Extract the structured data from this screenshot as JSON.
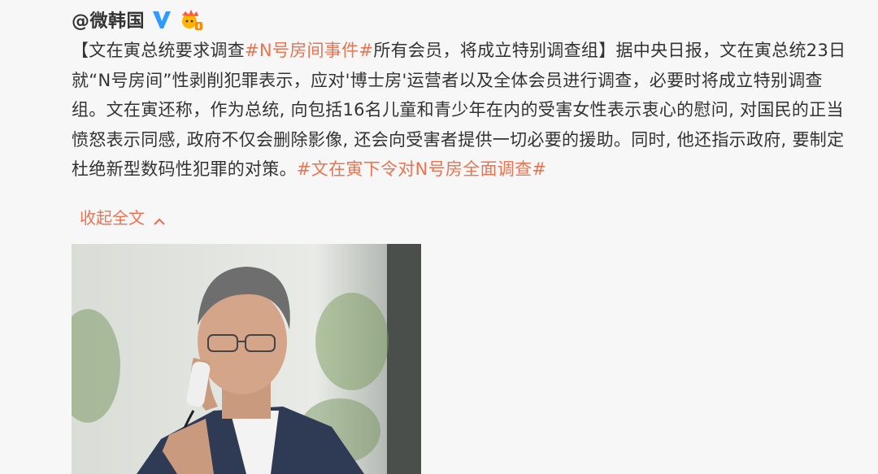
{
  "post": {
    "author": "@微韩国",
    "verified_icon": "verified-v-icon",
    "member_icon": "crown-member-icon",
    "text": {
      "lead": "【文在寅总统要求调查",
      "tag1": "#N号房间事件#",
      "body": "所有会员，将成立特别调查组】据中央日报，文在寅总统23日就“N号房间”性剥削犯罪表示，应对'博士房'运营者以及全体会员进行调查，必要时将成立特别调查组。文在寅还称，作为总统, 向包括16名儿童和青少年在内的受害女性表示衷心的慰问, 对国民的正当愤怒表示同感, 政府不仅会删除影像, 还会向受害者提供一切必要的援助。同时, 他还指示政府, 要制定杜绝新型数码性犯罪的对策。",
      "tag2": "#文在寅下令对N号房全面调查#"
    },
    "collapse_label": "收起全文",
    "collapse_icon": "chevron-up-icon",
    "colors": {
      "link": "#eb7350",
      "text": "#333333",
      "verified": "#2d9bff"
    }
  }
}
